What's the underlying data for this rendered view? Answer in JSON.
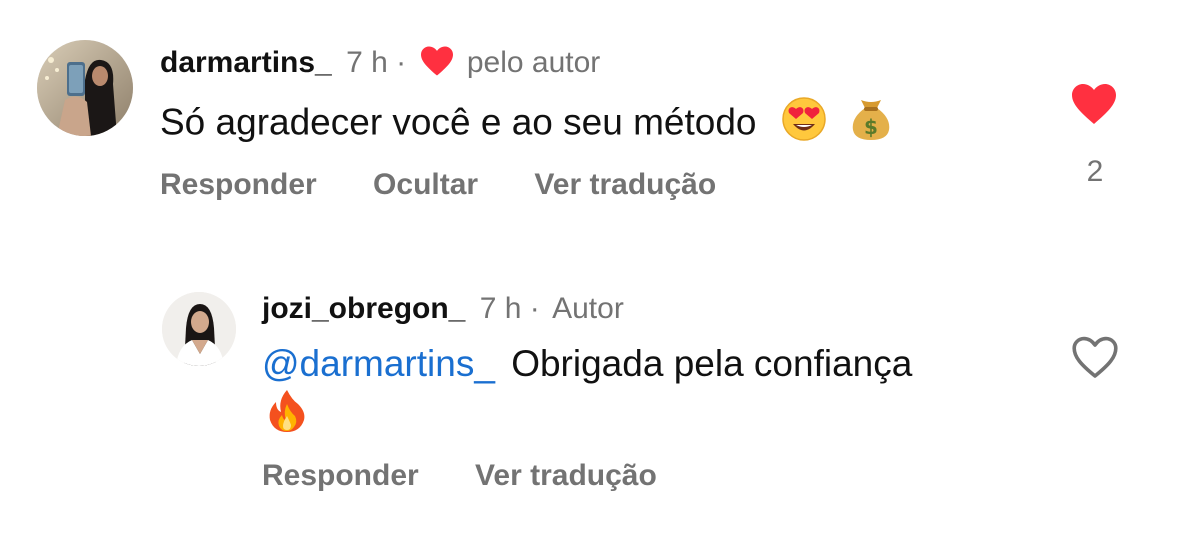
{
  "comments": [
    {
      "username": "darmartins_",
      "time": "7 h",
      "separator": "·",
      "liked_by_author_label": "pelo autor",
      "text": "Só agradecer você e ao seu método",
      "emojis": [
        "heart-eyes-emoji",
        "money-bag-emoji"
      ],
      "actions": {
        "reply": "Responder",
        "hide": "Ocultar",
        "translate": "Ver tradução"
      },
      "likes_count": "2",
      "liked": true
    },
    {
      "username": "jozi_obregon_",
      "time": "7 h",
      "separator": "·",
      "author_badge": "Autor",
      "mention": "@darmartins_",
      "text": "Obrigada pela confiança",
      "emojis": [
        "fire-emoji"
      ],
      "actions": {
        "reply": "Responder",
        "translate": "Ver tradução"
      },
      "liked": false
    }
  ],
  "colors": {
    "like_red": "#ff3040",
    "mention_blue": "#1a6fd0",
    "muted_gray": "#737373"
  }
}
